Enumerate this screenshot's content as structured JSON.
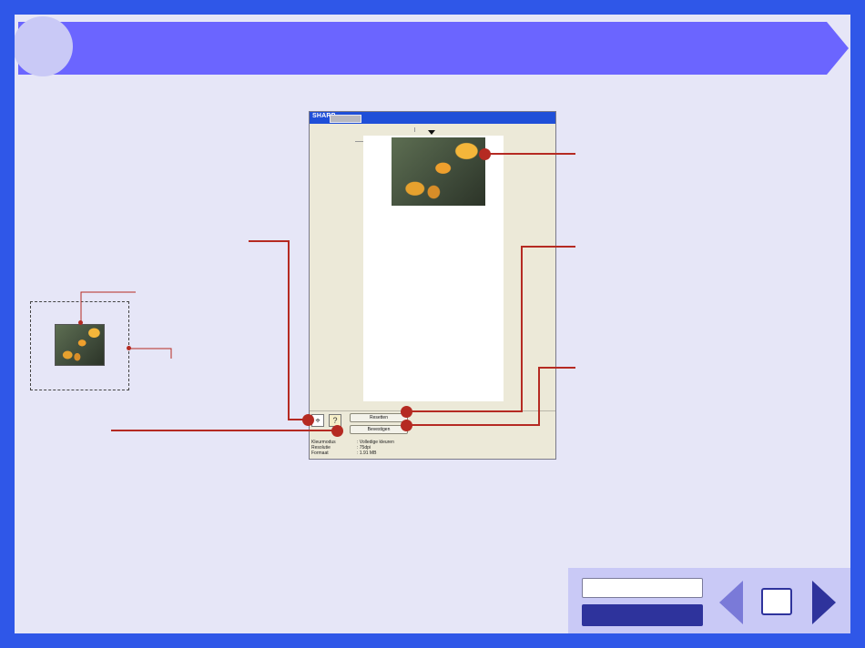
{
  "scanner_window": {
    "title_brand": "SHARP",
    "buttons": {
      "reset_label": "Resetten",
      "confirm_label": "Bevestigen"
    },
    "info": [
      {
        "label": "Kleurmodus",
        "value": "Volledige kleuren"
      },
      {
        "label": "Resolutie",
        "value": "75dpi"
      },
      {
        "label": "Formaat",
        "value": "1.91 MB"
      }
    ],
    "icons": {
      "cancel_scan": "scan-cancel-icon",
      "help": "help-question-icon"
    }
  },
  "colors": {
    "frame": "#2f57e8",
    "banner": "#6b65ff",
    "callout": "#b52a22",
    "nav_dark": "#2e339c"
  }
}
